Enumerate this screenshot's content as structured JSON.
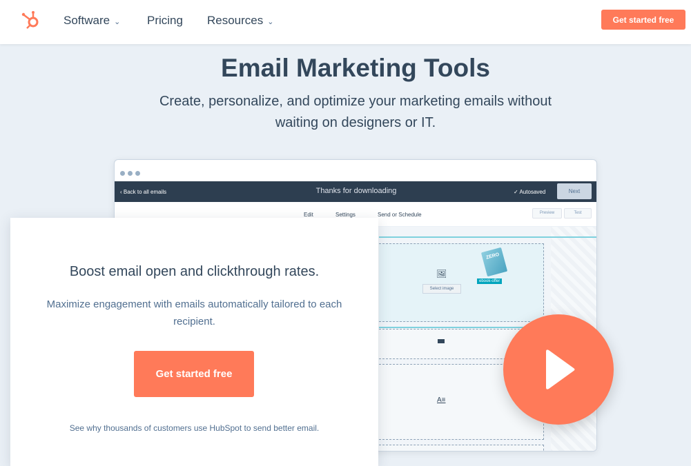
{
  "nav": {
    "items": [
      {
        "label": "Software",
        "dropdown": true
      },
      {
        "label": "Pricing",
        "dropdown": false
      },
      {
        "label": "Resources",
        "dropdown": true
      }
    ],
    "cta": "Get started free",
    "brand_color": "#ff7a59"
  },
  "hero": {
    "title": "Email Marketing Tools",
    "subtitle": "Create, personalize, and optimize your marketing emails without waiting on designers or IT."
  },
  "mockup": {
    "back": "Back to all emails",
    "title": "Thanks for downloading",
    "autosaved": "✓ Autosaved",
    "next": "Next",
    "tabs": [
      "Edit",
      "Settings",
      "Send or Schedule"
    ],
    "preview": "Preview",
    "test": "Test",
    "select_image": "Select image",
    "book_label": "ZERO",
    "tag": "ebook-offer"
  },
  "card": {
    "heading": "Boost email open and clickthrough rates.",
    "body": "Maximize engagement with emails automatically tailored to each recipient.",
    "cta": "Get started free",
    "footer": "See why thousands of customers use HubSpot to send better email."
  },
  "video": {
    "icon": "play-icon"
  }
}
